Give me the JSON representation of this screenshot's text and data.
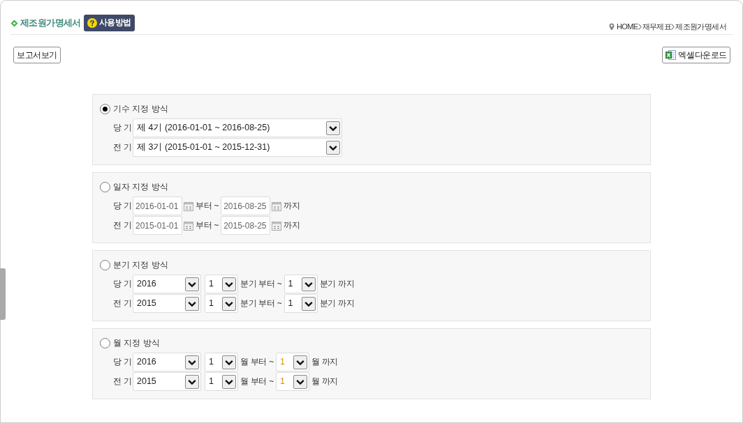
{
  "header": {
    "title": "제조원가명세서",
    "help_button": "사용방법",
    "breadcrumb": [
      "HOME",
      "재무제표",
      "제조원가명세서"
    ]
  },
  "toolbar": {
    "view_report_button": "보고서보기",
    "excel_button": "엑셀다운로드"
  },
  "panels": [
    {
      "kind": "period",
      "label": "기수 지정 방식",
      "selected": true,
      "rows": [
        {
          "label": "당 기",
          "period": "제 4기 (2016-01-01 ~ 2016-08-25)"
        },
        {
          "label": "전 기",
          "period": "제 3기 (2015-01-01 ~ 2015-12-31)"
        }
      ]
    },
    {
      "kind": "date",
      "label": "일자 지정 방식",
      "selected": false,
      "rows": [
        {
          "label": "당 기",
          "from": "2016-01-01",
          "from_suffix": "부터 ~",
          "to": "2016-08-25",
          "to_suffix": "까지"
        },
        {
          "label": "전 기",
          "from": "2015-01-01",
          "from_suffix": "부터 ~",
          "to": "2015-08-25",
          "to_suffix": "까지"
        }
      ]
    },
    {
      "kind": "quarter",
      "label": "분기 지정 방식",
      "selected": false,
      "rows": [
        {
          "label": "당 기",
          "year": "2016",
          "from": "1",
          "from_suffix": "분기 부터 ~",
          "to": "1",
          "to_suffix": "분기 까지"
        },
        {
          "label": "전 기",
          "year": "2015",
          "from": "1",
          "from_suffix": "분기 부터 ~",
          "to": "1",
          "to_suffix": "분기 까지"
        }
      ]
    },
    {
      "kind": "month",
      "label": "월 지정 방식",
      "selected": false,
      "rows": [
        {
          "label": "당 기",
          "year": "2016",
          "from": "1",
          "from_suffix": "월 부터 ~",
          "to": "1",
          "to_suffix": "월 까지"
        },
        {
          "label": "전 기",
          "year": "2015",
          "from": "1",
          "from_suffix": "월 부터 ~",
          "to": "1",
          "to_suffix": "월 까지"
        }
      ]
    }
  ]
}
